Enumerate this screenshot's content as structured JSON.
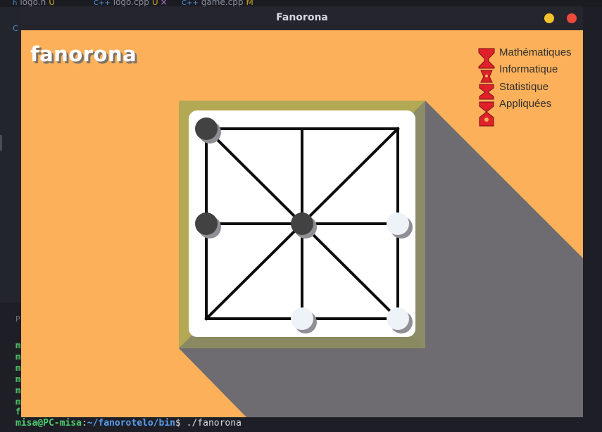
{
  "editor": {
    "tabs": [
      {
        "icon": "h",
        "name": "logo.h",
        "status": "U"
      },
      {
        "icon": "C++",
        "name": "logo.cpp",
        "status": "U",
        "close": "×"
      },
      {
        "icon": "C++",
        "name": "game.cpp",
        "status": "M"
      }
    ],
    "gutter_label": "C",
    "panel_label": "P",
    "terminal_letters": [
      "m",
      "m",
      "m",
      "m",
      "m",
      "m",
      "f"
    ],
    "prompt": {
      "user_host": "misa@PC-misa",
      "separator": ":",
      "path": "~/fanorotelo/bin",
      "dollar": "$",
      "command": " ./fanorona"
    }
  },
  "window": {
    "title": "Fanorona",
    "minimize_color": "#f4c22c",
    "close_color": "#ee4a3c"
  },
  "game": {
    "logo_text": "fanorona",
    "sponsor": {
      "lines": [
        "Mathématiques",
        "Informatique",
        "Statistique",
        "Appliquées"
      ],
      "logo_color": "#e0202a"
    },
    "board": {
      "background": "#fcb05a",
      "frame_color": "#b3a854",
      "shadow_color": "#6e6c71",
      "cells": 2,
      "pieces": [
        {
          "col": 0,
          "row": 0,
          "color": "black"
        },
        {
          "col": 0,
          "row": 1,
          "color": "black"
        },
        {
          "col": 1,
          "row": 1,
          "color": "black"
        },
        {
          "col": 2,
          "row": 1,
          "color": "white"
        },
        {
          "col": 1,
          "row": 2,
          "color": "white"
        },
        {
          "col": 2,
          "row": 2,
          "color": "white"
        }
      ]
    }
  }
}
